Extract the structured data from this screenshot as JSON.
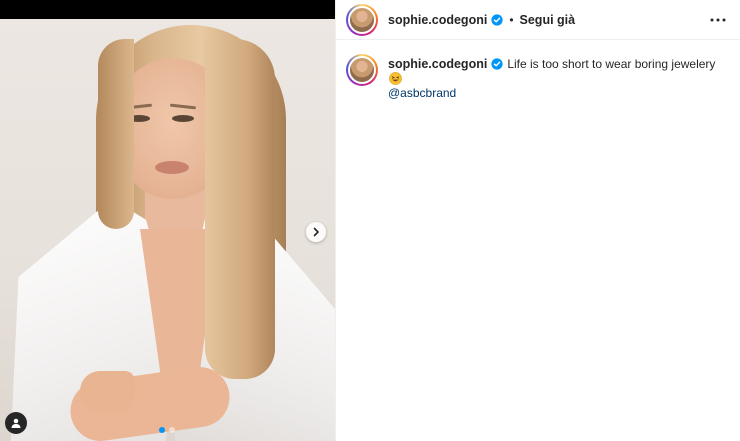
{
  "post": {
    "author": {
      "username": "sophie.codegoni",
      "verified": true,
      "follow_label": "Segui già",
      "separator": "•"
    },
    "caption": {
      "text": "Life is too short to wear boring jewelery",
      "emoji": "grinning-tongue-emoji",
      "mention": "@asbcbrand"
    },
    "carousel": {
      "current_index": 1,
      "total": 2
    },
    "icons": {
      "verified": "verified-badge-icon",
      "more": "more-options-icon",
      "next": "chevron-right-icon",
      "user_tag": "user-tag-icon"
    },
    "colors": {
      "verified_blue": "#0095f6",
      "mention": "#00376b",
      "text": "#262626"
    }
  }
}
